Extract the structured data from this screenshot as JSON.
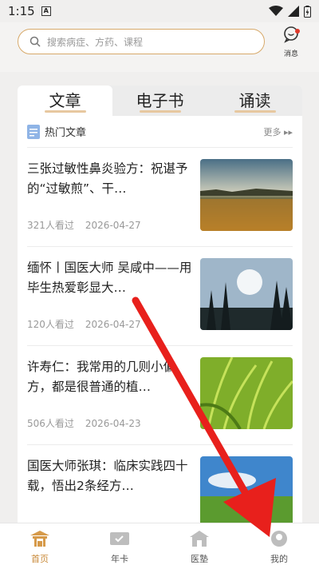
{
  "status_bar": {
    "time": "1:15",
    "notif_letter": "A"
  },
  "header": {
    "search_placeholder": "搜索病症、方药、课程",
    "message_label": "消息"
  },
  "tabs": [
    {
      "label": "文章"
    },
    {
      "label": "电子书"
    },
    {
      "label": "诵读"
    }
  ],
  "section": {
    "title": "热门文章",
    "more": "更多"
  },
  "articles": [
    {
      "title": "三张过敏性鼻炎验方：祝谌予的“过敏煎”、干…",
      "views": "321人看过",
      "date": "2026-04-27"
    },
    {
      "title": "缅怀丨国医大师 吴咸中——用毕生热爱彰显大…",
      "views": "120人看过",
      "date": "2026-04-27"
    },
    {
      "title": "许寿仁：我常用的几则小偏方，都是很普通的植…",
      "views": "506人看过",
      "date": "2026-04-23"
    },
    {
      "title": "国医大师张琪：临床实践四十载，悟出2条经方…",
      "views": "",
      "date": ""
    }
  ],
  "bottom_nav": [
    {
      "label": "首页"
    },
    {
      "label": "年卡"
    },
    {
      "label": "医塾"
    },
    {
      "label": "我的"
    }
  ],
  "colors": {
    "accent": "#c98a3a",
    "search_border": "#d7a96a",
    "annotation_arrow": "#e8201c"
  }
}
